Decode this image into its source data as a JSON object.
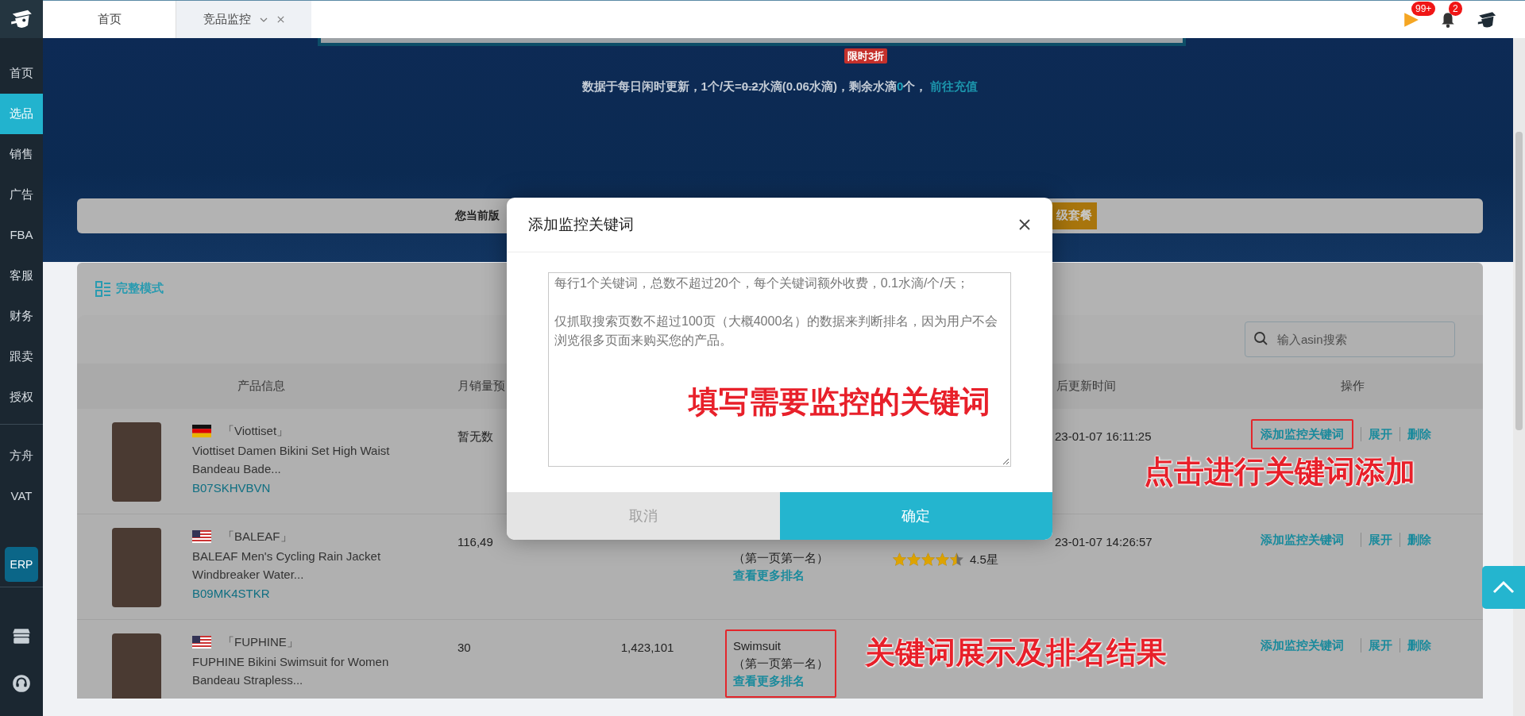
{
  "top_bar": {
    "tabs": [
      {
        "label": "首页",
        "selected": false,
        "closable": false
      },
      {
        "label": "竞品监控",
        "selected": true,
        "closable": true
      }
    ],
    "flag_badge": "99+",
    "bell_badge": "2"
  },
  "sidebar": {
    "sections": [
      {
        "items": [
          {
            "label": "首页",
            "kind": "link",
            "selected": false
          },
          {
            "label": "选品",
            "kind": "link",
            "selected": true
          },
          {
            "label": "销售",
            "kind": "link",
            "selected": false
          },
          {
            "label": "广告",
            "kind": "link",
            "selected": false
          },
          {
            "label": "FBA",
            "kind": "link",
            "selected": false
          },
          {
            "label": "客服",
            "kind": "link",
            "selected": false
          },
          {
            "label": "财务",
            "kind": "link",
            "selected": false
          },
          {
            "label": "跟卖",
            "kind": "link",
            "selected": false
          },
          {
            "label": "授权",
            "kind": "link",
            "selected": false
          }
        ]
      },
      {
        "items": [
          {
            "label": "方舟",
            "kind": "link",
            "selected": false
          },
          {
            "label": "VAT",
            "kind": "link",
            "selected": false
          },
          {
            "label": "ERP",
            "kind": "button",
            "selected": false
          }
        ]
      }
    ]
  },
  "banner": {
    "sale_tag": "限时3折",
    "info": [
      {
        "kind": "text",
        "text": "数据于每日闲时更新，1个/天="
      },
      {
        "kind": "strike",
        "text": "0.2"
      },
      {
        "kind": "text",
        "text": "水滴(0.06水滴)，剩余水滴"
      },
      {
        "kind": "highlight",
        "text": "0"
      },
      {
        "kind": "text",
        "text": "个，"
      },
      {
        "kind": "link",
        "text": "前往充值"
      }
    ]
  },
  "notice": {
    "text": "您当前版",
    "button": "级套餐"
  },
  "card": {
    "mode_label": "完整模式",
    "search": {
      "placeholder": "输入asin搜索"
    },
    "table": {
      "columns": [
        "产品信息",
        "月销量预",
        "后更新时间",
        "操作"
      ],
      "rows": [
        {
          "product": {
            "kind": "de",
            "brand": "「Viottiset」",
            "title": "Viottiset Damen Bikini Set High Waist Bandeau Bade...",
            "asin": "B07SKHVBVN"
          },
          "sales": "暂无数",
          "updated": "23-01-07 16:11:25",
          "actions": [
            "添加监控关键词",
            "展开",
            "删除"
          ],
          "action_highlighted": true
        },
        {
          "product": {
            "kind": "us",
            "brand": "「BALEAF」",
            "title": "BALEAF Men's Cycling Rain Jacket Windbreaker Water...",
            "asin": "B09MK4STKR"
          },
          "sales": "116,49",
          "keyword": {
            "rank": "（第一页第一名）",
            "more": "查看更多排名"
          },
          "stars": 4.5,
          "rating": "4.5星",
          "updated": "23-01-07 14:26:57",
          "actions": [
            "添加监控关键词",
            "展开",
            "删除"
          ],
          "action_highlighted": false,
          "keyword_highlighted": false
        },
        {
          "product": {
            "kind": "us",
            "brand": "「FUPHINE」",
            "title": "FUPHINE Bikini Swimsuit for Women Bandeau Strapless..."
          },
          "sales": "30",
          "sessions": "1,423,101",
          "keyword": {
            "word": "Swimsuit",
            "rank": "（第一页第一名）",
            "more": "查看更多排名"
          },
          "actions": [
            "添加监控关键词",
            "展开",
            "删除"
          ],
          "action_highlighted": false,
          "keyword_highlighted": true
        }
      ]
    }
  },
  "modal": {
    "title": "添加监控关键词",
    "placeholder": [
      "每行1个关键词，总数不超过20个，每个关键词额外收费，0.1水滴/个/天；",
      "仅抓取搜索页数不超过100页（大概4000名）的数据来判断排名，因为用户不会浏览很多页面来购买您的产品。"
    ],
    "annotation": "填写需要监控的关键词",
    "buttons": [
      {
        "label": "取消",
        "kind": "cancel"
      },
      {
        "label": "确定",
        "kind": "primary"
      }
    ]
  },
  "annotations": [
    "点击进行关键词添加",
    "关键词展示及排名结果"
  ]
}
